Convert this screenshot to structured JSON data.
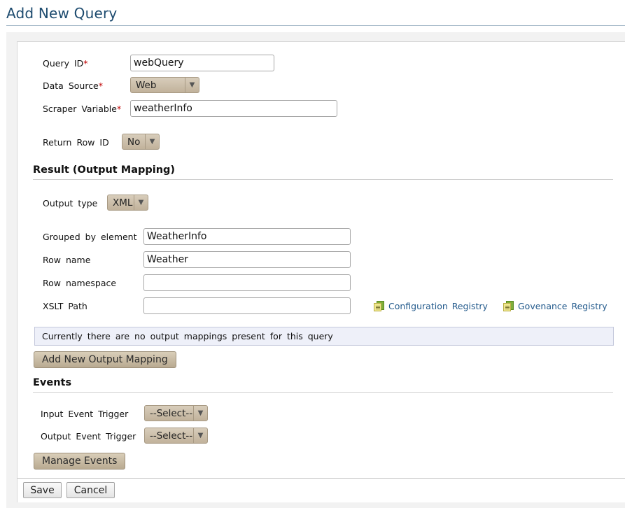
{
  "page": {
    "title": "Add New Query"
  },
  "form": {
    "query_id": {
      "label": "Query ID",
      "required_mark": "*",
      "value": "webQuery"
    },
    "data_source": {
      "label": "Data Source",
      "required_mark": "*",
      "selected": "Web"
    },
    "scraper_variable": {
      "label": "Scraper Variable",
      "required_mark": "*",
      "value": "weatherInfo"
    },
    "return_row_id": {
      "label": "Return Row ID",
      "selected": "No"
    }
  },
  "result_section": {
    "heading": "Result (Output Mapping)",
    "output_type": {
      "label": "Output type",
      "selected": "XML"
    },
    "grouped_by": {
      "label": "Grouped by element",
      "value": "WeatherInfo"
    },
    "row_name": {
      "label": "Row name",
      "value": "Weather"
    },
    "row_namespace": {
      "label": "Row namespace",
      "value": ""
    },
    "xslt_path": {
      "label": "XSLT Path",
      "value": ""
    },
    "config_registry_link": "Configuration Registry",
    "governance_registry_link": "Govenance Registry",
    "info_message": "Currently there are no output mappings present for this query",
    "add_mapping_button": "Add New Output Mapping"
  },
  "events_section": {
    "heading": "Events",
    "input_trigger": {
      "label": "Input Event Trigger",
      "selected": "--Select--"
    },
    "output_trigger": {
      "label": "Output Event Trigger",
      "selected": "--Select--"
    },
    "manage_button": "Manage Events"
  },
  "footer": {
    "save_label": "Save",
    "cancel_label": "Cancel"
  },
  "icons": {
    "dropdown": "chevron-down-icon",
    "registry": "registry-browse-icon"
  },
  "colors": {
    "title": "#1c4a6e",
    "link": "#235a8c",
    "required": "#c00000",
    "button": "#c8bba5"
  }
}
